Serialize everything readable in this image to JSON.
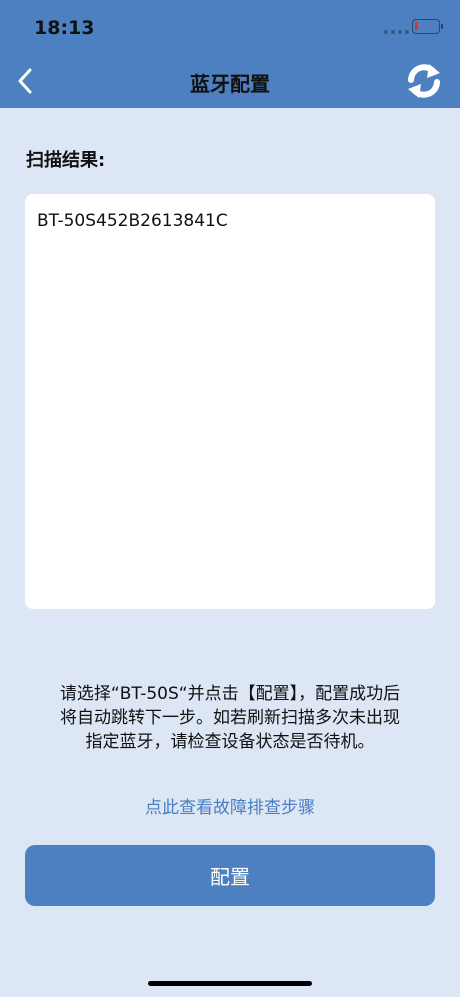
{
  "status_bar": {
    "time": "18:13",
    "battery_color": "#e0312e"
  },
  "nav": {
    "title": "蓝牙配置",
    "back_icon": "chevron-left-icon",
    "refresh_icon": "refresh-icon"
  },
  "scan": {
    "label": "扫描结果:",
    "results": [
      "BT-50S452B2613841C"
    ]
  },
  "instructions": {
    "lines": [
      "请选择“BT-50S“并点击【配置】，配置成功后",
      "将自动跳转下一步。如若刷新扫描多次未出现",
      "指定蓝牙，请检查设备状态是否待机。"
    ]
  },
  "troubleshoot_link": "点此查看故障排查步骤",
  "config_button": "配置",
  "colors": {
    "primary": "#4d80c0",
    "background": "#dce6f5",
    "link": "#4a7fc0"
  }
}
